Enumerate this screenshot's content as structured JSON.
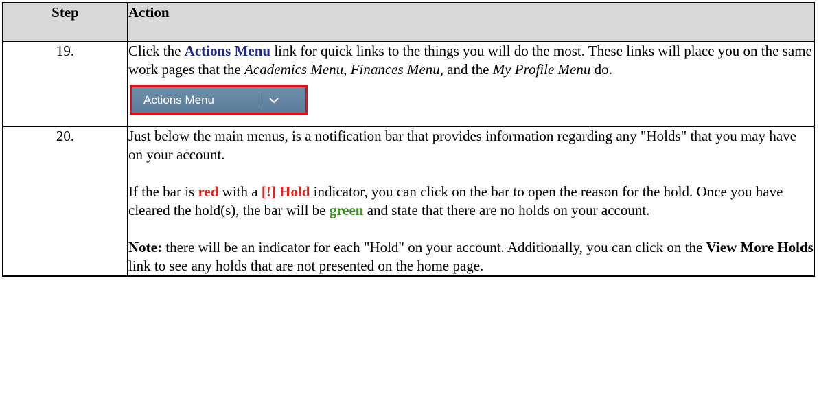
{
  "header": {
    "step": "Step",
    "action": "Action"
  },
  "rows": [
    {
      "num": "19.",
      "p1": {
        "a": "Click the ",
        "link": "Actions Menu",
        "b": " link for quick links to the things you will do the most. These links will place you on the same work pages that the ",
        "m1": "Academics Menu,",
        "c": " ",
        "m2": "Finances Menu,",
        "d": " and the ",
        "m3": "My Profile Menu",
        "e": " do."
      },
      "button": {
        "label": "Actions Menu",
        "icon": "chevron-down-icon"
      }
    },
    {
      "num": "20.",
      "p1": "Just below the main menus, is a notification bar that provides information regarding any \"Holds\" that you may have on your account.",
      "p2": {
        "a": "If the bar is ",
        "red": "red",
        "b": " with a ",
        "hold": "[!] Hold",
        "c": " indicator, you can click on the bar to open the reason for the hold. Once you have cleared the hold(s), the bar will be ",
        "green": "green",
        "d": " and state that there are no holds on your account."
      },
      "p3": {
        "note": "Note:",
        "a": " there will be an indicator for each \"Hold\" on your account. Additionally, you can click on the ",
        "link": "View More Holds",
        "b": " link to see any holds that are not presented on the home page."
      }
    }
  ],
  "colors": {
    "red": "#e5221d",
    "green": "#3a8f1c",
    "button": "#5f819d"
  }
}
